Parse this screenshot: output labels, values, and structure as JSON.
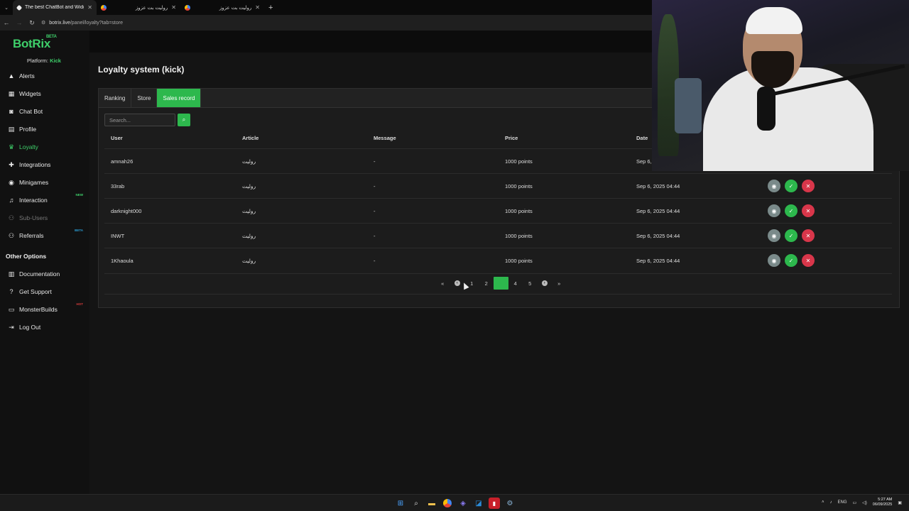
{
  "browser": {
    "tabs": [
      {
        "title": "The best ChatBot and Widgets",
        "active": true
      },
      {
        "title": "روليت بت عزوز",
        "active": false
      },
      {
        "title": "روليت بت عزوز",
        "active": false
      }
    ],
    "url_host": "botrix.live",
    "url_path": "/panel/loyalty?tab=store"
  },
  "sidebar": {
    "logo": "BotRix",
    "logo_badge": "BETA",
    "platform_label": "Platform:",
    "platform_value": "Kick",
    "items": [
      {
        "label": "Alerts",
        "icon": "warning-icon"
      },
      {
        "label": "Widgets",
        "icon": "grid-icon"
      },
      {
        "label": "Chat Bot",
        "icon": "robot-icon"
      },
      {
        "label": "Profile",
        "icon": "id-card-icon"
      },
      {
        "label": "Loyalty",
        "icon": "trophy-icon"
      },
      {
        "label": "Integrations",
        "icon": "puzzle-icon"
      },
      {
        "label": "Minigames",
        "icon": "gamepad-icon"
      },
      {
        "label": "Interaction",
        "icon": "music-icon",
        "badge": "NEW"
      },
      {
        "label": "Sub-Users",
        "icon": "users-icon"
      },
      {
        "label": "Referrals",
        "icon": "users-icon",
        "badge": "BETA"
      }
    ],
    "other_title": "Other Options",
    "other_items": [
      {
        "label": "Documentation",
        "icon": "book-icon"
      },
      {
        "label": "Get Support",
        "icon": "question-icon"
      },
      {
        "label": "MonsterBuilds",
        "icon": "laptop-icon",
        "badge": "HOT"
      },
      {
        "label": "Log Out",
        "icon": "logout-icon"
      }
    ]
  },
  "main": {
    "title": "Loyalty system (kick)",
    "tabs": [
      "Ranking",
      "Store",
      "Sales record"
    ],
    "search_placeholder": "Search...",
    "columns": [
      "User",
      "Article",
      "Message",
      "Price",
      "Date"
    ],
    "rows": [
      {
        "user": "amnah26",
        "article": "روليت",
        "message": "-",
        "price": "1000 points",
        "date": "Sep 6,"
      },
      {
        "user": "33rab",
        "article": "روليت",
        "message": "-",
        "price": "1000 points",
        "date": "Sep 6, 2025 04:44"
      },
      {
        "user": "darknight000",
        "article": "روليت",
        "message": "-",
        "price": "1000 points",
        "date": "Sep 6, 2025 04:44"
      },
      {
        "user": "INWT",
        "article": "روليت",
        "message": "-",
        "price": "1000 points",
        "date": "Sep 6, 2025 04:44"
      },
      {
        "user": "1Khaoula",
        "article": "روليت",
        "message": "-",
        "price": "1000 points",
        "date": "Sep 6, 2025 04:44"
      }
    ],
    "pagination": {
      "first": "«",
      "prev": "‹",
      "pages": [
        "1",
        "2",
        "3",
        "4",
        "5"
      ],
      "current": "3",
      "next": "›",
      "last": "»"
    }
  },
  "taskbar": {
    "lang": "ENG",
    "time": "5:27 AM",
    "date": "06/09/2025"
  },
  "colors": {
    "accent": "#2db84d",
    "danger": "#d8364a",
    "neutral": "#7a8a8a"
  }
}
